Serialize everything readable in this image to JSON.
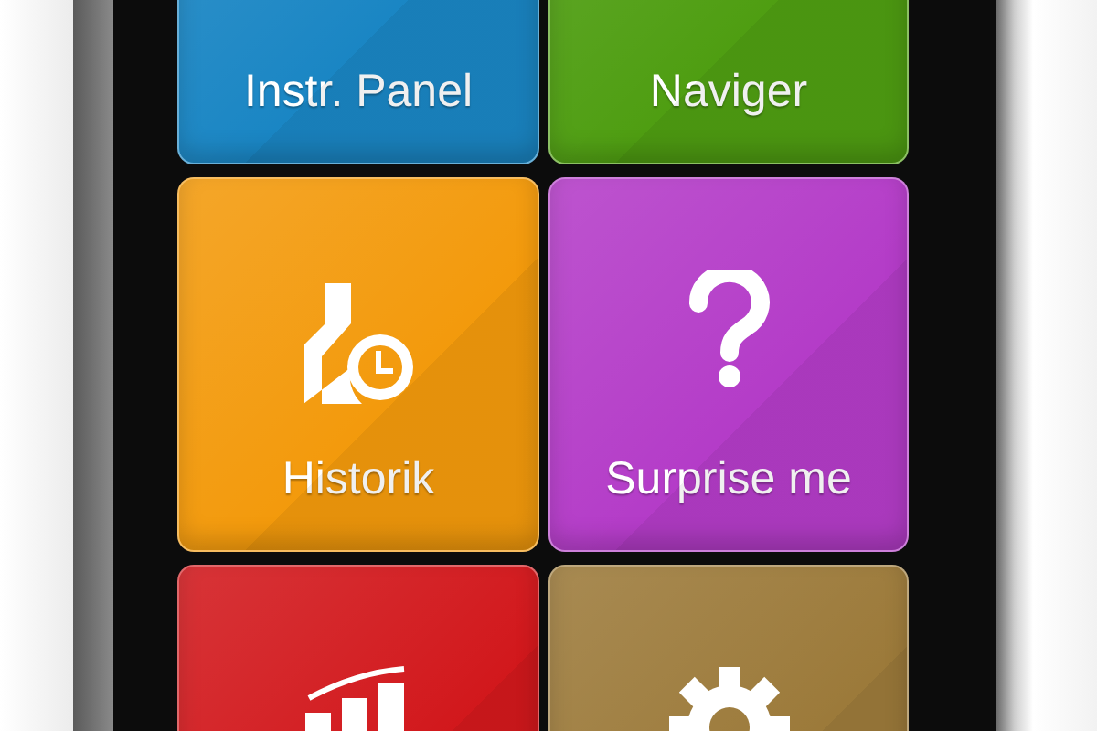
{
  "tiles": [
    {
      "label": "Instr. Panel",
      "color": "#1a86c4"
    },
    {
      "label": "Naviger",
      "color": "#4f9e12"
    },
    {
      "label": "Historik",
      "color": "#f39a0c"
    },
    {
      "label": "Surprise me",
      "color": "#b43cc8"
    },
    {
      "color": "#d2181c"
    },
    {
      "color": "#9c7a3a"
    }
  ]
}
